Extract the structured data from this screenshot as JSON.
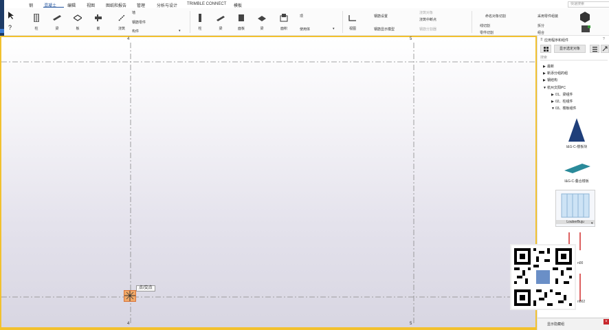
{
  "menu": {
    "tabs": [
      "钢",
      "混凝土",
      "编辑",
      "视图",
      "图纸和报告",
      "管理",
      "分析与设计",
      "TRIMBLE CONNECT",
      "模板"
    ],
    "active_index": 1,
    "search_placeholder": "快速搜索"
  },
  "ribbon": {
    "buttons": [
      {
        "label": "柱",
        "icon": "column-icon"
      },
      {
        "label": "梁",
        "icon": "beam-icon"
      },
      {
        "label": "板",
        "icon": "slab-icon"
      },
      {
        "label": "嵌",
        "icon": "embed-icon"
      },
      {
        "label": "楼板",
        "icon": "floor-icon"
      },
      {
        "label": "浇筑",
        "icon": "pour-icon"
      },
      {
        "label": "柱",
        "icon": "column2-icon"
      },
      {
        "label": "梁",
        "icon": "beam2-icon"
      },
      {
        "label": "面板",
        "icon": "panel-icon"
      },
      {
        "label": "梁",
        "icon": "beam3-icon"
      },
      {
        "label": "面积",
        "icon": "area-icon"
      },
      {
        "label": "视图",
        "icon": "view-icon"
      }
    ],
    "small_items": {
      "wall": "墙",
      "rebar_part": "钢筋零件",
      "component": "构件",
      "item": "项",
      "solid": "使用体",
      "rebar_settings": "钢筋设置",
      "rebar_display": "钢筋显示模型",
      "pour_object": "浇筑对象",
      "pour_break": "浇筑中断点",
      "rebar_splitter": "钢筋分割器",
      "object_cut": "命名对象切割",
      "line_cut": "线切割",
      "part_cut": "零件切割",
      "parts_group": "采用零件组装",
      "split": "拆分",
      "combine": "组合"
    }
  },
  "viewport": {
    "grid_labels": {
      "top_a": "4",
      "top_b": "5",
      "bottom_a": "4",
      "bottom_b": "5"
    },
    "snap_tooltip": "点/交点"
  },
  "right_panel": {
    "header": "应用程序和组件",
    "show_button": "显示选定对象",
    "search_placeholder": "搜索",
    "tree": [
      {
        "label": "最新",
        "expanded": false,
        "level": 0
      },
      {
        "label": "新添分组的组",
        "expanded": false,
        "level": 0
      },
      {
        "label": "钢结构",
        "expanded": false,
        "level": 0
      },
      {
        "label": "杭州文阳PC",
        "expanded": true,
        "level": 0
      },
      {
        "label": "01、梁组件",
        "expanded": false,
        "level": 1
      },
      {
        "label": "02、柱组件",
        "expanded": false,
        "level": 1
      },
      {
        "label": "03、楼板组件",
        "expanded": true,
        "level": 1
      }
    ],
    "components": [
      {
        "label": "I&G-C-楼板块",
        "icon": "triangle-icon"
      },
      {
        "label": "I&G-C-叠合楼板",
        "icon": "slab-plate-icon"
      },
      {
        "label": "LouberBuju",
        "icon": "louver-icon"
      }
    ],
    "side_labels": [
      "n00",
      "n002"
    ],
    "bottom_label": "显示隐藏组"
  },
  "colors": {
    "accent": "#1d4f9a",
    "viewport_border": "#f2c12e",
    "snap_marker": "#f0a868"
  }
}
